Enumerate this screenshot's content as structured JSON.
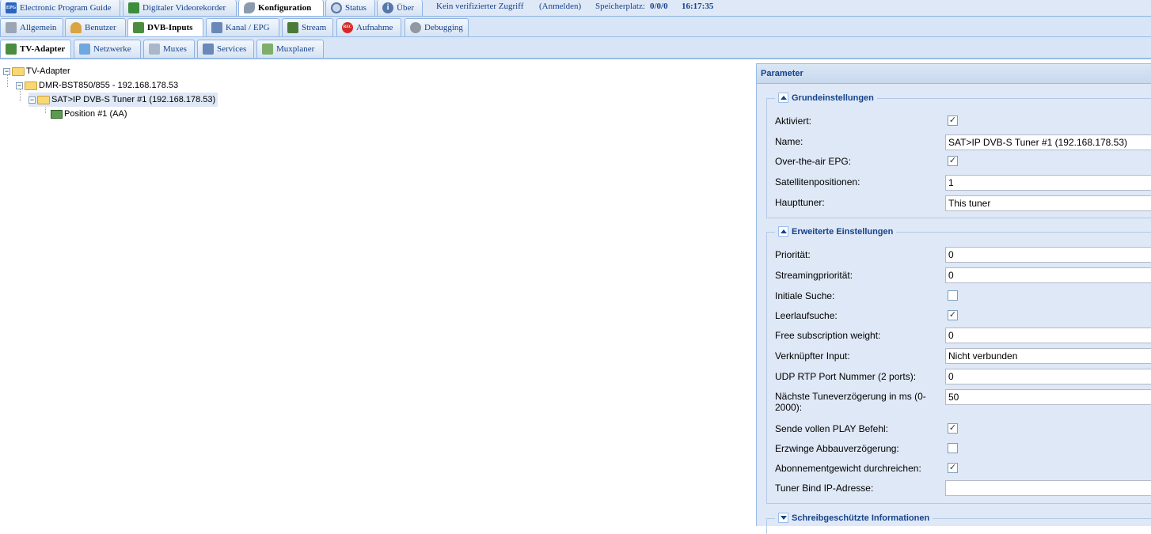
{
  "top_tabs": [
    {
      "label": "Electronic Program Guide",
      "icon": "epg-icon",
      "icon_text": "EPG"
    },
    {
      "label": "Digitaler Videorekorder",
      "icon": "download-icon"
    },
    {
      "label": "Konfiguration",
      "icon": "wrench-icon"
    },
    {
      "label": "Status",
      "icon": "eye-icon"
    },
    {
      "label": "Über",
      "icon": "info-icon"
    }
  ],
  "status": {
    "access": "Kein verifizierter Zugriff",
    "login": "(Anmelden)",
    "storage_label": "Speicherplatz:",
    "storage_value": "0/0/0",
    "time": "16:17:35"
  },
  "config_tabs": [
    {
      "label": "Allgemein",
      "icon": "tools-icon"
    },
    {
      "label": "Benutzer",
      "icon": "user-icon"
    },
    {
      "label": "DVB-Inputs",
      "icon": "card-icon"
    },
    {
      "label": "Kanal / EPG",
      "icon": "tv-icon"
    },
    {
      "label": "Stream",
      "icon": "stream-icon"
    },
    {
      "label": "Aufnahme",
      "icon": "rec-icon",
      "icon_text": "REC"
    },
    {
      "label": "Debugging",
      "icon": "gears-icon"
    }
  ],
  "dvb_tabs": [
    {
      "label": "TV-Adapter",
      "icon": "card-icon"
    },
    {
      "label": "Netzwerke",
      "icon": "antenna-icon"
    },
    {
      "label": "Muxes",
      "icon": "satellite-icon"
    },
    {
      "label": "Services",
      "icon": "tv-icon"
    },
    {
      "label": "Muxplaner",
      "icon": "calendar-check-icon"
    }
  ],
  "tree": [
    {
      "label": "TV-Adapter"
    },
    {
      "label": "DMR-BST850/855 - 192.168.178.53"
    },
    {
      "label": "SAT>IP DVB-S Tuner #1 (192.168.178.53)"
    },
    {
      "label": "Position #1 (AA)"
    }
  ],
  "panel": {
    "title": "Parameter",
    "basic": {
      "legend": "Grundeinstellungen",
      "enabled_label": "Aktiviert:",
      "enabled": true,
      "name_label": "Name:",
      "name_value": "SAT>IP DVB-S Tuner #1 (192.168.178.53)",
      "epg_label": "Over-the-air EPG:",
      "epg": true,
      "satpos_label": "Satellitenpositionen:",
      "satpos_value": "1",
      "master_label": "Haupttuner:",
      "master_value": "This tuner"
    },
    "advanced": {
      "legend": "Erweiterte Einstellungen",
      "priority_label": "Priorität:",
      "priority_value": "0",
      "spriority_label": "Streamingpriorität:",
      "spriority_value": "0",
      "initscan_label": "Initiale Suche:",
      "initscan": false,
      "idlescan_label": "Leerlaufsuche:",
      "idlescan": true,
      "freeweight_label": "Free subscription weight:",
      "freeweight_value": "0",
      "linked_label": "Verknüpfter Input:",
      "linked_value": "Nicht verbunden",
      "udp_label": "UDP RTP Port Nummer (2 ports):",
      "udp_value": "0",
      "tunedelay_label": "Nächste Tuneverzögerung in ms (0-2000):",
      "tunedelay_value": "50",
      "fullplay_label": "Sende vollen PLAY Befehl:",
      "fullplay": true,
      "teardown_label": "Erzwinge Abbauverzögerung:",
      "teardown": false,
      "passweight_label": "Abonnementgewicht durchreichen:",
      "passweight": true,
      "bindip_label": "Tuner Bind IP-Adresse:",
      "bindip_value": ""
    },
    "readonly": {
      "legend": "Schreibgeschützte Informationen"
    }
  },
  "colors": {
    "accent": "#15428b",
    "panel_bg": "#dfe8f6",
    "border": "#99bbe8"
  }
}
